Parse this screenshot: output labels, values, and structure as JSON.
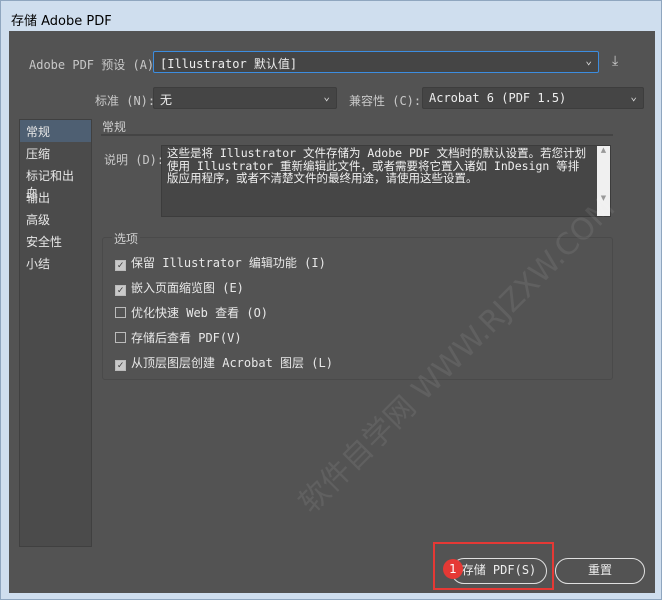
{
  "window": {
    "title": "存储 Adobe PDF"
  },
  "preset": {
    "label": "Adobe PDF 预设 (A):",
    "value": "[Illustrator 默认值]"
  },
  "standard": {
    "label": "标准 (N):",
    "value": "无"
  },
  "compat": {
    "label": "兼容性 (C):",
    "value": "Acrobat 6 (PDF 1.5)"
  },
  "sidebar": {
    "items": [
      {
        "label": "常规"
      },
      {
        "label": "压缩"
      },
      {
        "label": "标记和出血"
      },
      {
        "label": "输出"
      },
      {
        "label": "高级"
      },
      {
        "label": "安全性"
      },
      {
        "label": "小结"
      }
    ]
  },
  "section": {
    "title": "常规",
    "desc_label": "说明 (D):",
    "description": "这些是将 Illustrator 文件存储为 Adobe PDF 文档时的默认设置。若您计划使用 Illustrator 重新编辑此文件，或者需要将它置入诸如 InDesign 等排版应用程序，或者不清楚文件的最终用途，请使用这些设置。"
  },
  "options": {
    "title": "选项",
    "items": [
      {
        "label": "保留 Illustrator 编辑功能 (I)",
        "checked": true
      },
      {
        "label": "嵌入页面缩览图 (E)",
        "checked": true
      },
      {
        "label": "优化快速 Web 查看 (O)",
        "checked": false
      },
      {
        "label": "存储后查看 PDF(V)",
        "checked": false
      },
      {
        "label": "从顶层图层创建 Acrobat 图层 (L)",
        "checked": true
      }
    ]
  },
  "buttons": {
    "save": "存储 PDF(S)",
    "reset": "重置",
    "badge": "1"
  },
  "watermark": "软件自学网 WWW.RJZXW.COM"
}
